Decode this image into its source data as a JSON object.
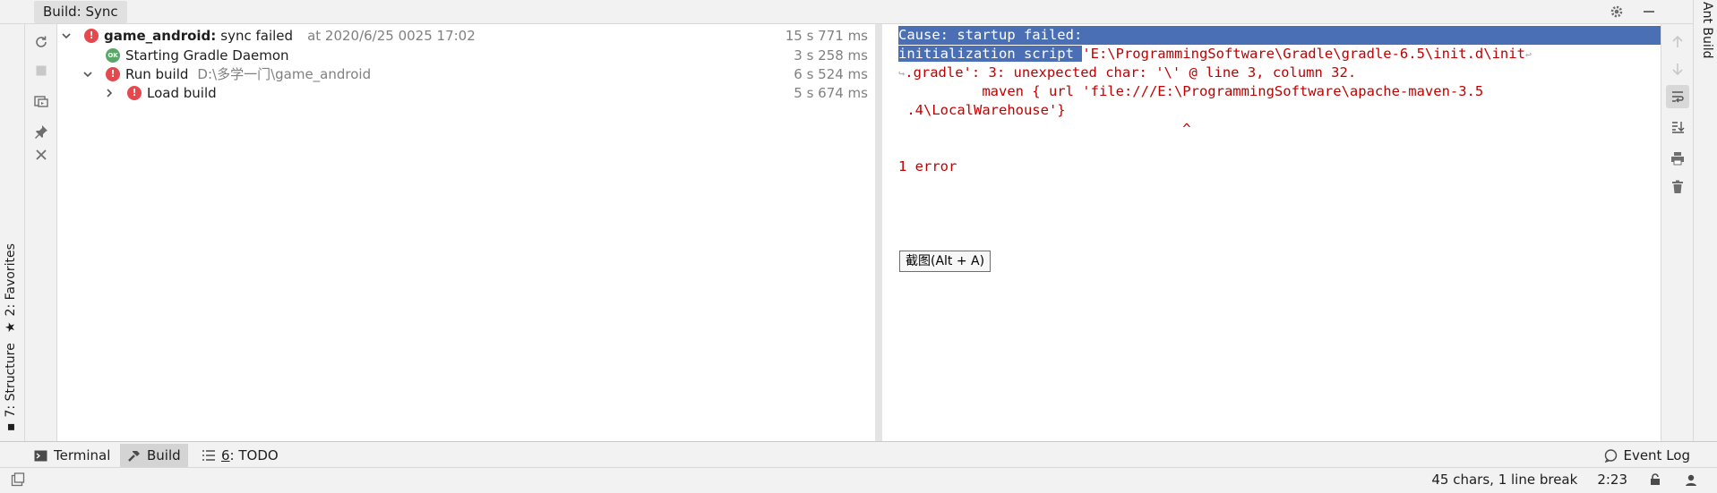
{
  "window": {
    "panel_title": "Build: Sync"
  },
  "left_strip": {
    "favorites_label": "2: Favorites",
    "structure_label": "7: Structure"
  },
  "right_strip": {
    "ant_build_label": "Ant Build"
  },
  "tree": {
    "rows": [
      {
        "name": "game_android:",
        "status": "sync failed",
        "time": "at 2020/6/25 0025 17:02",
        "duration": "15 s 771 ms"
      },
      {
        "name": "Starting Gradle Daemon",
        "duration": "3 s 258 ms",
        "ok_badge": "OK"
      },
      {
        "name": "Run build",
        "path": "D:\\多学一门\\game_android",
        "duration": "6 s 524 ms"
      },
      {
        "name": "Load build",
        "duration": "5 s 674 ms"
      }
    ]
  },
  "console": {
    "lines": [
      "Cause: startup failed:",
      "initialization script ",
      "'E:\\ProgrammingSoftware\\Gradle\\gradle-6.5\\init.d\\init",
      ".gradle': 3: unexpected char: '\\' @ line 3, column 32.",
      "          maven { url 'file:///E:\\ProgrammingSoftware\\apache-maven-3.5",
      " .4\\LocalWarehouse'}",
      "                                  ^",
      "1 error"
    ],
    "tooltip": "截图(Alt + A)"
  },
  "bottom_tabs": {
    "terminal": "Terminal",
    "build": "Build",
    "todo_key": "6",
    "todo": ": TODO",
    "event_log": "Event Log"
  },
  "status": {
    "chars": "45 chars, 1 line break",
    "position": "2:23"
  },
  "colors": {
    "error": "#e5484d",
    "ok": "#59a869",
    "console_text": "#c00000",
    "selection": "#4a6fb5"
  }
}
